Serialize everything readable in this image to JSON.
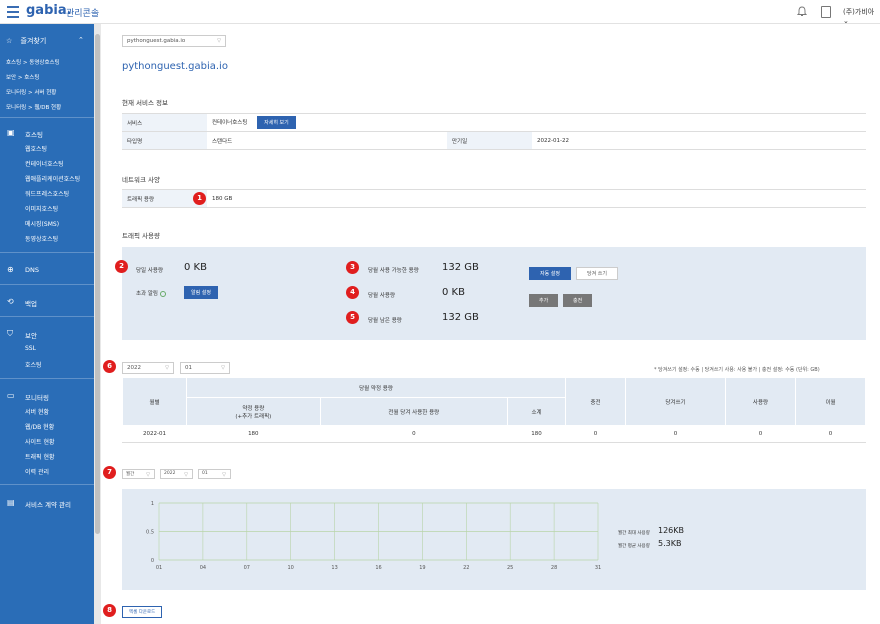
{
  "app": {
    "logo": "gabia.",
    "console": "관리콘솔",
    "user": "(주)가비아"
  },
  "sidebar": {
    "favorites": "즐겨찾기",
    "fav_links": [
      "호스팅 > 동영상호스팅",
      "보안 > 호스팅",
      "모니터링 > 서버 현황",
      "모니터링 > 웹/DB 현황"
    ],
    "hosting": {
      "label": "호스팅",
      "items": [
        "웹호스팅",
        "컨테이너호스팅",
        "웹애플리케이션호스팅",
        "워드프레스호스팅",
        "이미지호스팅",
        "메시징(SMS)",
        "동영상호스팅"
      ]
    },
    "dns": "DNS",
    "backup": "백업",
    "security": {
      "label": "보안",
      "items": [
        "SSL",
        "호스팅"
      ]
    },
    "monitoring": {
      "label": "모니터링",
      "items": [
        "서버 현황",
        "웹/DB 현황",
        "사이트 현황",
        "트래픽 현황",
        "이력 관리"
      ]
    },
    "contract": "서비스 계약 관리"
  },
  "main": {
    "domain_select": "pythonguest.gabia.io",
    "domain_title": "pythonguest.gabia.io",
    "service_info_title": "현재 서비스 정보",
    "service_label": "서비스",
    "service_value": "컨테이너호스팅",
    "detail_button": "자세히 보기",
    "type_label": "타입명",
    "type_value": "스탠다드",
    "expire_label": "만기일",
    "expire_value": "2022-01-22",
    "network_title": "네트워크 사양",
    "traffic_label": "트래픽 용량",
    "traffic_value": "180 GB",
    "traffic_usage_title": "트래픽 사용량",
    "today_label": "당일 사용량",
    "today_value": "0 KB",
    "alert_label": "초과 알림",
    "alert_button": "알림 설정",
    "avail_label": "당월 사용 가능한 용량",
    "avail_value": "132 GB",
    "month_used_label": "당월 사용량",
    "month_used_value": "0 KB",
    "remain_label": "당월 남은 용량",
    "remain_value": "132 GB",
    "auto_button": "자동 설정",
    "borrow_button": "당겨 쓰기",
    "add_button": "추가",
    "charge_button": "충전",
    "year_select": "2022",
    "month_select": "01",
    "note": "* 당겨쓰기 설정: 수동 | 당겨쓰기 사용: 사용 불가 | 충전 설정: 수동 (단위: GB)",
    "table": {
      "h_month": "월별",
      "h_contract": "당월 약정 용량",
      "h_contract_sub": "약정 용량\n(+추가 트래픽)",
      "h_prev": "전월 당겨 사용한 용량",
      "h_sum": "소계",
      "h_charge": "충전",
      "h_borrow": "당겨쓰기",
      "h_used": "사용량",
      "h_carry": "이월",
      "row": [
        "2022-01",
        "180",
        "0",
        "180",
        "0",
        "0",
        "0",
        "0"
      ]
    },
    "chart_filter": [
      "월간",
      "2022",
      "01"
    ],
    "excel_button": "엑셀 다운로드",
    "stat_max_label": "월간 최대 사용량",
    "stat_max_value": "126KB",
    "stat_avg_label": "월간 평균 사용량",
    "stat_avg_value": "5.3KB"
  },
  "markers": [
    "1",
    "2",
    "3",
    "4",
    "5",
    "6",
    "7",
    "8"
  ],
  "chart_data": {
    "type": "line",
    "x": [
      "01",
      "04",
      "07",
      "10",
      "13",
      "16",
      "19",
      "22",
      "25",
      "28",
      "31"
    ],
    "y_ticks": [
      "0",
      "0.5",
      "1"
    ],
    "ylim": [
      0,
      1
    ],
    "grid": true
  }
}
